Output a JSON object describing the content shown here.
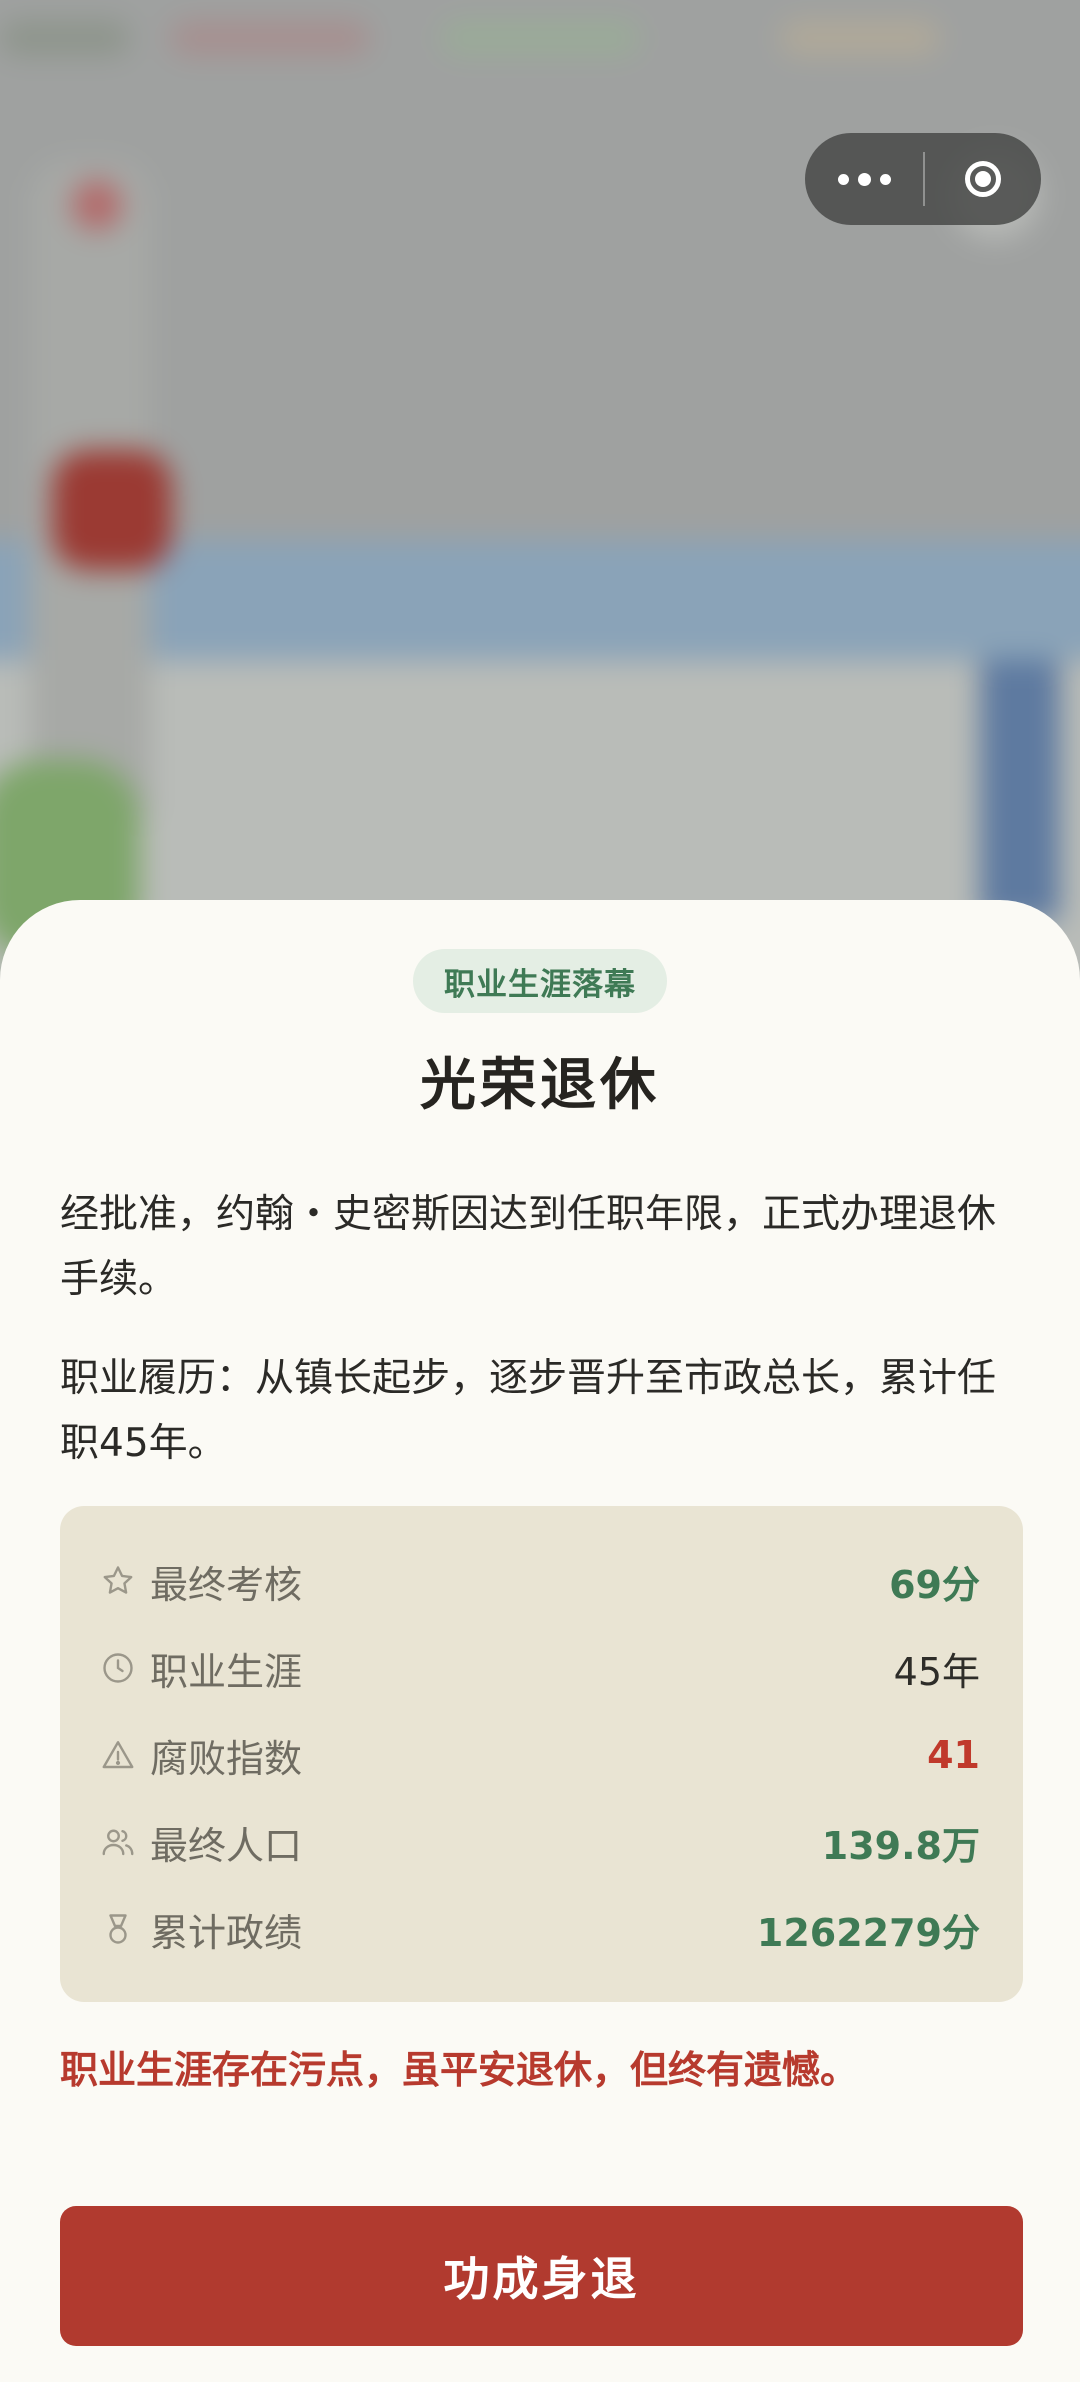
{
  "sheet": {
    "badge": "职业生涯落幕",
    "title": "光荣退休",
    "paragraph1": "经批准，约翰・史密斯因达到任职年限，正式办理退休手续。",
    "paragraph2": "职业履历：从镇长起步，逐步晋升至市政总长，累计任职45年。",
    "stats": [
      {
        "icon": "star-icon",
        "label": "最终考核",
        "value": "69分",
        "color": "#3f7a55"
      },
      {
        "icon": "clock-icon",
        "label": "职业生涯",
        "value": "45年",
        "color": "#2e2d29"
      },
      {
        "icon": "warning-triangle-icon",
        "label": "腐败指数",
        "value": "41",
        "color": "#c0392b"
      },
      {
        "icon": "people-icon",
        "label": "最终人口",
        "value": "139.8万",
        "color": "#3f7a55"
      },
      {
        "icon": "medal-icon",
        "label": "累计政绩",
        "value": "1262279分",
        "color": "#3f7a55"
      }
    ],
    "warning": "职业生涯存在污点，虽平安退休，但终有遗憾。",
    "cta_label": "功成身退"
  },
  "capsule": {
    "more_icon": "more-dots-icon",
    "close_icon": "target-circle-icon"
  },
  "colors": {
    "accent_red": "#b13a2f",
    "accent_green": "#3f7a55",
    "sheet_bg": "#fbfaf5",
    "stats_bg": "#e9e4d3"
  }
}
